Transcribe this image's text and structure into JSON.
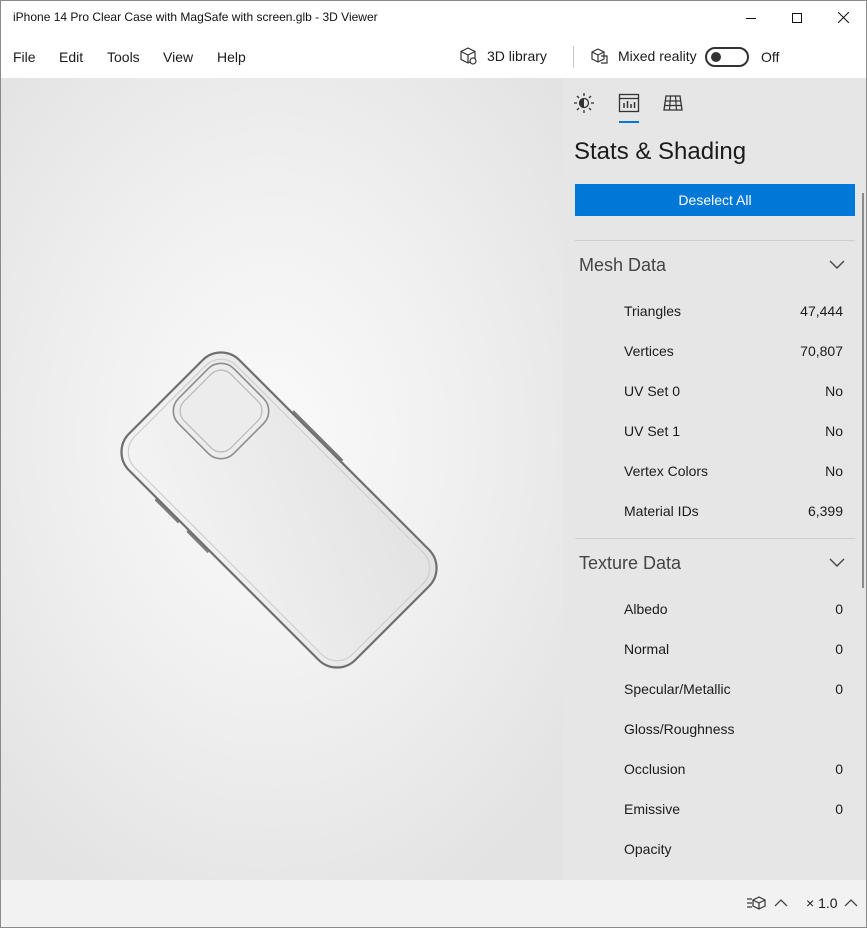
{
  "window": {
    "title": "iPhone 14 Pro Clear Case with MagSafe with screen.glb - 3D Viewer"
  },
  "menu": {
    "items": [
      "File",
      "Edit",
      "Tools",
      "View",
      "Help"
    ]
  },
  "toolbar": {
    "library_label": "3D library",
    "mixed_reality_label": "Mixed reality",
    "toggle_state": "Off"
  },
  "panel": {
    "title": "Stats & Shading",
    "deselect_label": "Deselect All",
    "accent": "#0078d7",
    "mesh": {
      "heading": "Mesh Data",
      "rows": [
        {
          "label": "Triangles",
          "value": "47,444"
        },
        {
          "label": "Vertices",
          "value": "70,807"
        },
        {
          "label": "UV Set 0",
          "value": "No"
        },
        {
          "label": "UV Set 1",
          "value": "No"
        },
        {
          "label": "Vertex Colors",
          "value": "No"
        },
        {
          "label": "Material IDs",
          "value": "6,399"
        }
      ]
    },
    "texture": {
      "heading": "Texture Data",
      "rows": [
        {
          "label": "Albedo",
          "value": "0"
        },
        {
          "label": "Normal",
          "value": "0"
        },
        {
          "label": "Specular/Metallic",
          "value": "0"
        },
        {
          "label": "Gloss/Roughness",
          "value": ""
        },
        {
          "label": "Occlusion",
          "value": "0"
        },
        {
          "label": "Emissive",
          "value": "0"
        },
        {
          "label": "Opacity",
          "value": ""
        }
      ]
    }
  },
  "status": {
    "zoom": "× 1.0"
  }
}
